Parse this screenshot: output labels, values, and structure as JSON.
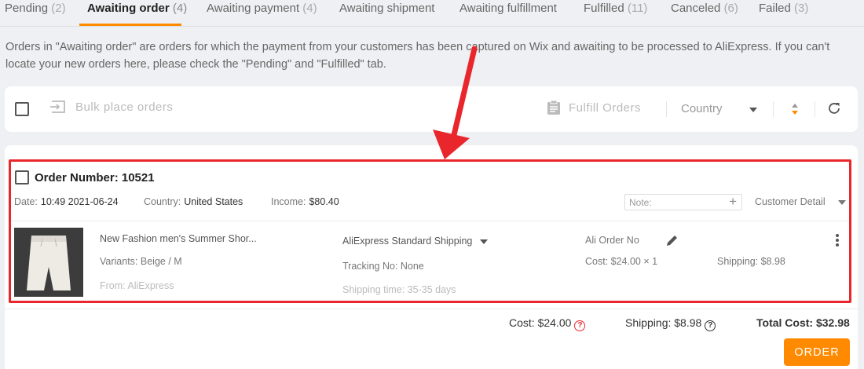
{
  "tabs": [
    {
      "label": "Pending",
      "count": "(2)"
    },
    {
      "label": "Awaiting order",
      "count": "(4)"
    },
    {
      "label": "Awaiting payment",
      "count": "(4)"
    },
    {
      "label": "Awaiting shipment",
      "count": ""
    },
    {
      "label": "Awaiting fulfillment",
      "count": ""
    },
    {
      "label": "Fulfilled",
      "count": "(11)"
    },
    {
      "label": "Canceled",
      "count": "(6)"
    },
    {
      "label": "Failed",
      "count": "(3)"
    }
  ],
  "active_tab": "Awaiting order",
  "info_text": "Orders in \"Awaiting order\" are orders for which the payment from your customers has been captured on Wix and awaiting to be processed to AliExpress. If you can't locate your new orders here, please check the \"Pending\" and \"Fulfilled\" tab.",
  "toolbar": {
    "bulk_label": "Bulk place orders",
    "fulfill_label": "Fulfill Orders",
    "country_placeholder": "Country"
  },
  "order": {
    "title": "Order Number: 10521",
    "date_label": "Date:",
    "date_value": "10:49 2021-06-24",
    "country_label": "Country:",
    "country_value": "United States",
    "income_label": "Income:",
    "income_value": "$80.40",
    "note_placeholder": "Note:",
    "customer_detail": "Customer Detail",
    "product": {
      "name": "New Fashion men's Summer Shor...",
      "variants": "Variants: Beige / M",
      "from": "From: AliExpress",
      "shipping_method": "AliExpress Standard Shipping",
      "tracking": "Tracking No: None",
      "shipping_time": "Shipping time: 35-35 days",
      "ali_order_no": "Ali Order No",
      "cost": "Cost: $24.00 × 1",
      "shipping": "Shipping: $8.98"
    },
    "summary": {
      "cost": "Cost: $24.00",
      "shipping": "Shipping: $8.98",
      "total": "Total Cost: $32.98"
    },
    "order_button": "ORDER"
  },
  "colors": {
    "accent": "#ff8a00",
    "highlight": "#e8262b",
    "background": "#eef0f3"
  }
}
